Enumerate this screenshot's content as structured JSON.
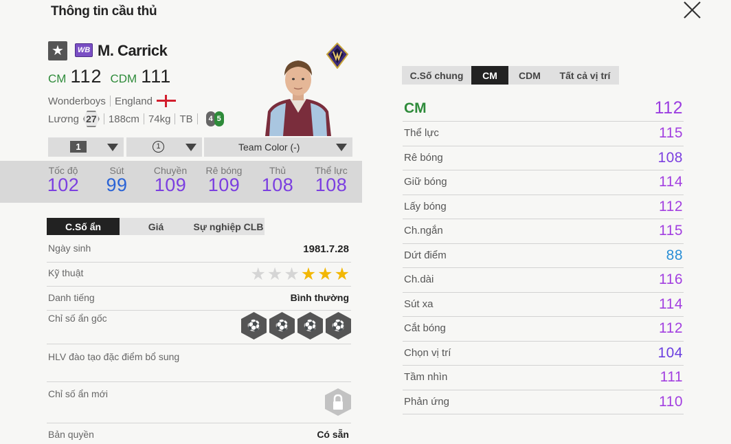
{
  "dialog": {
    "title": "Thông tin cầu thủ"
  },
  "player": {
    "name": "M. Carrick",
    "season_code": "WB",
    "positions": [
      {
        "pos": "CM",
        "ovr": "112"
      },
      {
        "pos": "CDM",
        "ovr": "111"
      }
    ],
    "club": "Wonderboys",
    "nation": "England",
    "wage_label": "Lương",
    "wage": "27",
    "height": "188cm",
    "weight": "74kg",
    "body_type": "TB",
    "weak_foot_left": "4",
    "weak_foot_right": "5"
  },
  "selectors": {
    "level": "1",
    "upgrade": "1",
    "team_color": "Team Color (-)"
  },
  "main_stats": [
    {
      "label": "Tốc độ",
      "value": "102"
    },
    {
      "label": "Sút",
      "value": "99"
    },
    {
      "label": "Chuyền",
      "value": "109"
    },
    {
      "label": "Rê bóng",
      "value": "109"
    },
    {
      "label": "Thủ",
      "value": "108"
    },
    {
      "label": "Thể lực",
      "value": "108"
    }
  ],
  "info_tabs": [
    "C.Số ẩn",
    "Giá",
    "Sự nghiệp CLB"
  ],
  "info": {
    "birth_label": "Ngày sinh",
    "birth": "1981.7.28",
    "skill_label": "Kỹ thuật",
    "skill_stars": 3,
    "skill_max": 6,
    "reputation_label": "Danh tiếng",
    "reputation": "Bình thường",
    "hidden_traits_label": "Chỉ số ẩn gốc",
    "hidden_traits": [
      "long-shot-taker-icon",
      "playmaker-icon",
      "long-passer-icon",
      "power-header-icon"
    ],
    "coach_label": "HLV đào tạo đặc điểm bổ sung",
    "new_traits_label": "Chỉ số ẩn mới",
    "license_label": "Bản quyền",
    "license": "Có sẵn"
  },
  "detail_tabs": [
    "C.Số chung",
    "CM",
    "CDM",
    "Tất cả vị trí"
  ],
  "detail": {
    "head": {
      "label": "CM",
      "value": "112"
    },
    "rows": [
      {
        "label": "Thể lực",
        "value": "115",
        "color": "#a23fe0"
      },
      {
        "label": "Rê bóng",
        "value": "108",
        "color": "#7b3fe0"
      },
      {
        "label": "Giữ bóng",
        "value": "114",
        "color": "#a23fe0"
      },
      {
        "label": "Lấy bóng",
        "value": "112",
        "color": "#a23fe0"
      },
      {
        "label": "Ch.ngắn",
        "value": "115",
        "color": "#a23fe0"
      },
      {
        "label": "Dứt điểm",
        "value": "88",
        "color": "#2a8fd6"
      },
      {
        "label": "Ch.dài",
        "value": "116",
        "color": "#a23fe0"
      },
      {
        "label": "Sút xa",
        "value": "114",
        "color": "#a23fe0"
      },
      {
        "label": "Cắt bóng",
        "value": "112",
        "color": "#a23fe0"
      },
      {
        "label": "Chọn vị trí",
        "value": "104",
        "color": "#6a3ee0"
      },
      {
        "label": "Tầm nhìn",
        "value": "111",
        "color": "#a23fe0"
      },
      {
        "label": "Phản ứng",
        "value": "110",
        "color": "#a23fe0"
      }
    ]
  }
}
